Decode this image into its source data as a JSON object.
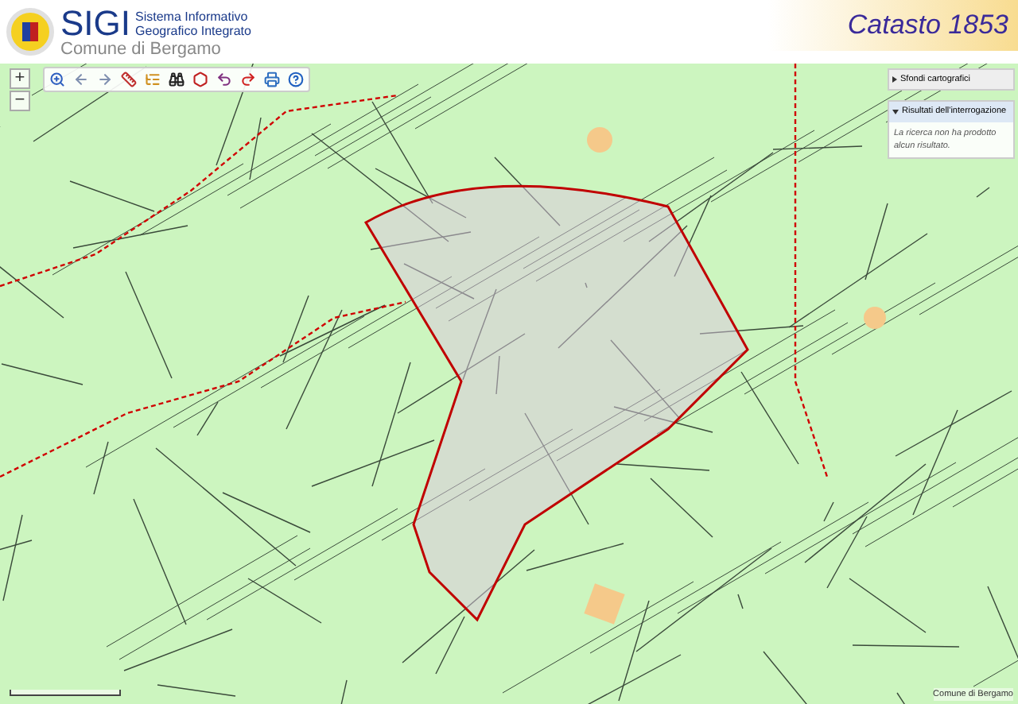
{
  "header": {
    "title": "SIGI",
    "subtitle_line_1": "Sistema Informativo",
    "subtitle_line_2": "Geografico Integrato",
    "organization": "Comune di Bergamo",
    "banner": "Catasto 1853"
  },
  "zoom_controls": [
    "+",
    "−"
  ],
  "panels": [
    {
      "title": "Sfondi cartografici",
      "expanded": false
    },
    {
      "title": "Risultati dell'interrogazione",
      "expanded": true,
      "message": "La ricerca non ha prodotto alcun risultato."
    }
  ],
  "attribution": "Comune di Bergamo"
}
